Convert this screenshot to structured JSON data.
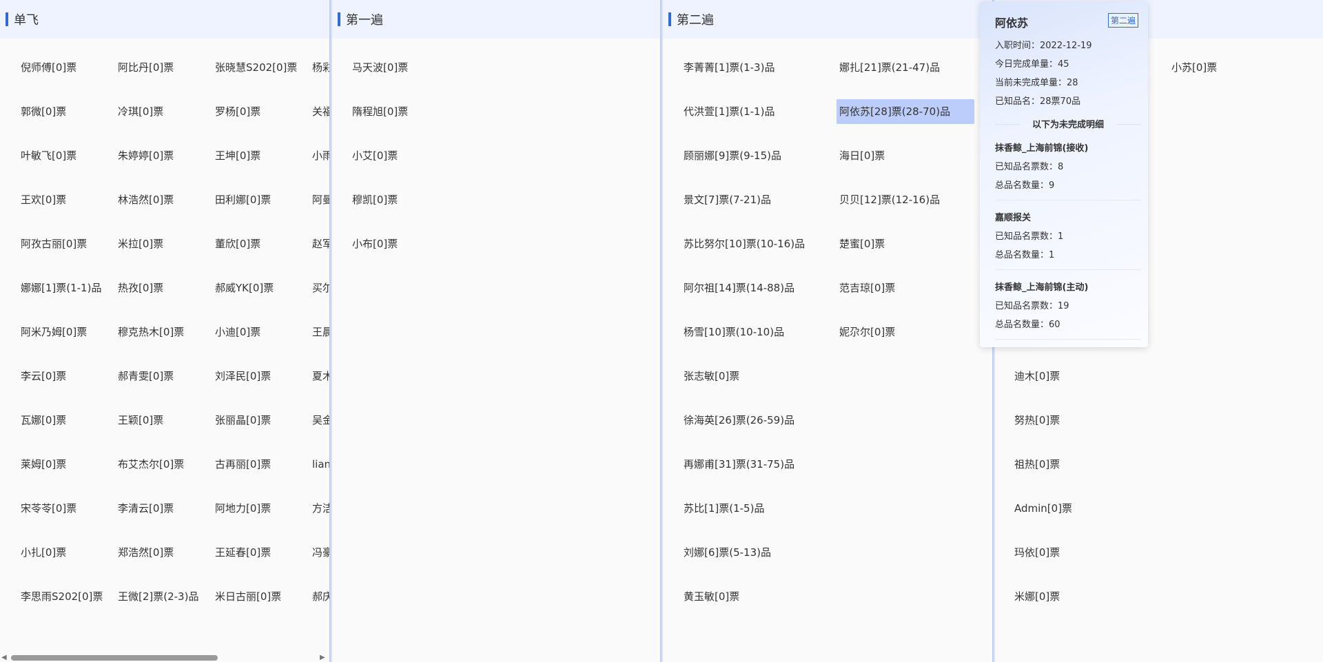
{
  "columns": [
    {
      "title": "单飞"
    },
    {
      "title": "第一遍"
    },
    {
      "title": "第二遍"
    }
  ],
  "col1": {
    "rows": [
      [
        "倪师傅[0]票",
        "阿比丹[0]票",
        "张晓慧S202[0]票",
        "杨彩"
      ],
      [
        "郭微[0]票",
        "冷琪[0]票",
        "罗杨[0]票",
        "关福"
      ],
      [
        "叶敏飞[0]票",
        "朱婷婷[0]票",
        "王坤[0]票",
        "小雨"
      ],
      [
        "王欢[0]票",
        "林浩然[0]票",
        "田利娜[0]票",
        "阿曼"
      ],
      [
        "阿孜古丽[0]票",
        "米拉[0]票",
        "董欣[0]票",
        "赵军"
      ],
      [
        "娜娜[1]票(1-1)品",
        "热孜[0]票",
        "郝威YK[0]票",
        "买尔"
      ],
      [
        "阿米乃姆[0]票",
        "穆克热木[0]票",
        "小迪[0]票",
        "王晨"
      ],
      [
        "李云[0]票",
        "郝青雯[0]票",
        "刘泽民[0]票",
        "夏木"
      ],
      [
        "瓦娜[0]票",
        "王颖[0]票",
        "张丽晶[0]票",
        "吴金"
      ],
      [
        "莱姆[0]票",
        "布艾杰尔[0]票",
        "古再丽[0]票",
        "lian"
      ],
      [
        "宋苓苓[0]票",
        "李清云[0]票",
        "阿地力[0]票",
        "方洁"
      ],
      [
        "小扎[0]票",
        "郑浩然[0]票",
        "王延春[0]票",
        "冯豪"
      ],
      [
        "李思雨S202[0]票",
        "王微[2]票(2-3)品",
        "米日古丽[0]票",
        "郝庆"
      ]
    ]
  },
  "col2": {
    "items": [
      "马天波[0]票",
      "隋程旭[0]票",
      "小艾[0]票",
      "穆凯[0]票",
      "小布[0]票"
    ]
  },
  "col3": {
    "left": [
      "李菁菁[1]票(1-3)品",
      "代洪萱[1]票(1-1)品",
      "顾丽娜[9]票(9-15)品",
      "景文[7]票(7-21)品",
      "苏比努尔[10]票(10-16)品",
      "阿尔祖[14]票(14-88)品",
      "杨雪[10]票(10-10)品",
      "张志敏[0]票",
      "徐海英[26]票(26-59)品",
      "再娜甫[31]票(31-75)品",
      "苏比[1]票(1-5)品",
      "刘娜[6]票(5-13)品",
      "黄玉敏[0]票"
    ],
    "right": [
      "娜扎[21]票(21-47)品",
      "阿依苏[28]票(28-70)品",
      "海日[0]票",
      "贝贝[12]票(12-16)品",
      "楚蜜[0]票",
      "范吉琼[0]票",
      "妮尕尔[0]票"
    ]
  },
  "col4": {
    "top_right": "小苏[0]票",
    "items": [
      "迪木[0]票",
      "努热[0]票",
      "祖热[0]票",
      "Admin[0]票",
      "玛依[0]票",
      "米娜[0]票"
    ]
  },
  "popover": {
    "name": "阿依苏",
    "tag": "第二遍",
    "join_date": "入职时间：2022-12-19",
    "today_done": "今日完成单量：45",
    "pending": "当前未完成单量：28",
    "known": "已知品名：28票70品",
    "section_title": "以下为未完成明细",
    "groups": [
      {
        "name": "抹香鲸_上海前锦(接收)",
        "known": "已知品名票数：8",
        "total": "总品名数量：9"
      },
      {
        "name": "嘉顺报关",
        "known": "已知品名票数：1",
        "total": "总品名数量：1"
      },
      {
        "name": "抹香鲸_上海前锦(主动)",
        "known": "已知品名票数：19",
        "total": "总品名数量：60"
      }
    ]
  },
  "scrollbar": {
    "left_arrow": "◀",
    "right_arrow": "▶"
  }
}
